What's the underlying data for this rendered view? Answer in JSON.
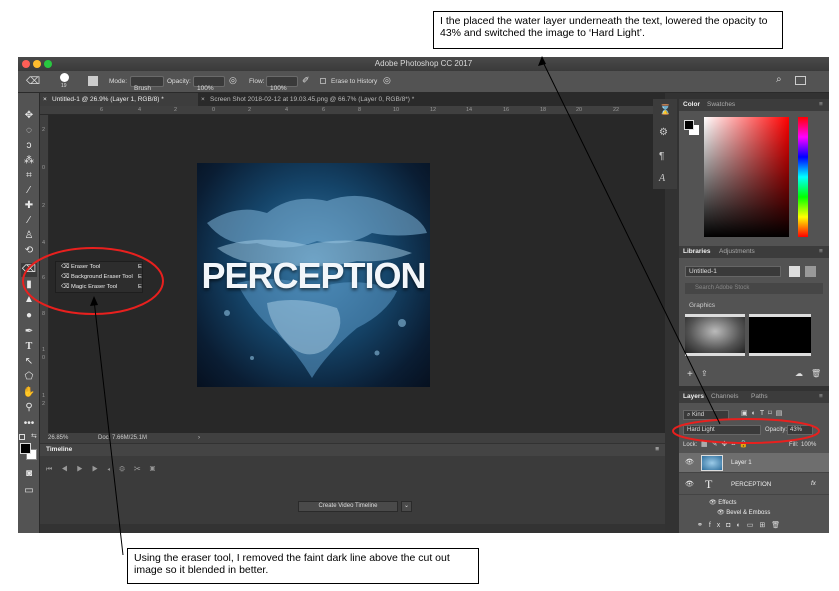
{
  "notes": {
    "top": "I the placed the water layer underneath the text, lowered the opacity to 43% and switched the image to ‘Hard Light’.",
    "bottom": "Using the eraser tool, I removed the faint dark line above the cut out image so it blended in better."
  },
  "app": {
    "title": "Adobe Photoshop CC 2017"
  },
  "options": {
    "brush_size": "19",
    "mode_label": "Mode:",
    "mode_value": "Brush",
    "opacity_label": "Opacity:",
    "opacity_value": "100%",
    "flow_label": "Flow:",
    "flow_value": "100%",
    "erase_history": "Erase to History"
  },
  "tabs": [
    {
      "label": "Untitled-1 @ 26.9% (Layer 1, RGB/8) *"
    },
    {
      "label": "Screen Shot 2018-02-12 at 19.03.45.png @ 66.7% (Layer 0, RGB/8*) *"
    }
  ],
  "ruler_h": [
    "6",
    "4",
    "2",
    "0",
    "2",
    "4",
    "6",
    "8",
    "10",
    "12",
    "14",
    "16",
    "18",
    "20",
    "22"
  ],
  "ruler_v": [
    "2",
    "0",
    "2",
    "4",
    "6",
    "8",
    "1",
    "0",
    "1",
    "2"
  ],
  "canvas": {
    "text": "PERCEPTION"
  },
  "flyout": {
    "items": [
      {
        "label": "Eraser Tool",
        "key": "E"
      },
      {
        "label": "Background Eraser Tool",
        "key": "E"
      },
      {
        "label": "Magic Eraser Tool",
        "key": "E"
      }
    ]
  },
  "status": {
    "zoom": "26.85%",
    "doc": "Doc: 7.66M/25.1M"
  },
  "timeline": {
    "title": "Timeline",
    "create_button": "Create Video Timeline"
  },
  "color_panel": {
    "tabs": [
      "Color",
      "Swatches"
    ]
  },
  "libraries": {
    "tabs": [
      "Libraries",
      "Adjustments"
    ],
    "library_name": "Untitled-1",
    "search_placeholder": "Search Adobe Stock",
    "section": "Graphics"
  },
  "layers_panel": {
    "tabs": [
      "Layers",
      "Channels",
      "Paths"
    ],
    "filter": "Kind",
    "blend_mode": "Hard Light",
    "opacity_label": "Opacity:",
    "opacity_value": "43%",
    "lock_label": "Lock:",
    "fill_label": "Fill:",
    "fill_value": "100%",
    "layers": [
      {
        "name": "Layer 1",
        "type": "image"
      },
      {
        "name": "PERCEPTION",
        "type": "text"
      }
    ],
    "effects_label": "Effects",
    "effect_items": [
      "Bevel & Emboss"
    ]
  },
  "colors": {
    "annotation_red": "#e8201e",
    "mac_red": "#fe5f57",
    "mac_yellow": "#febc2e",
    "mac_green": "#28c840"
  }
}
